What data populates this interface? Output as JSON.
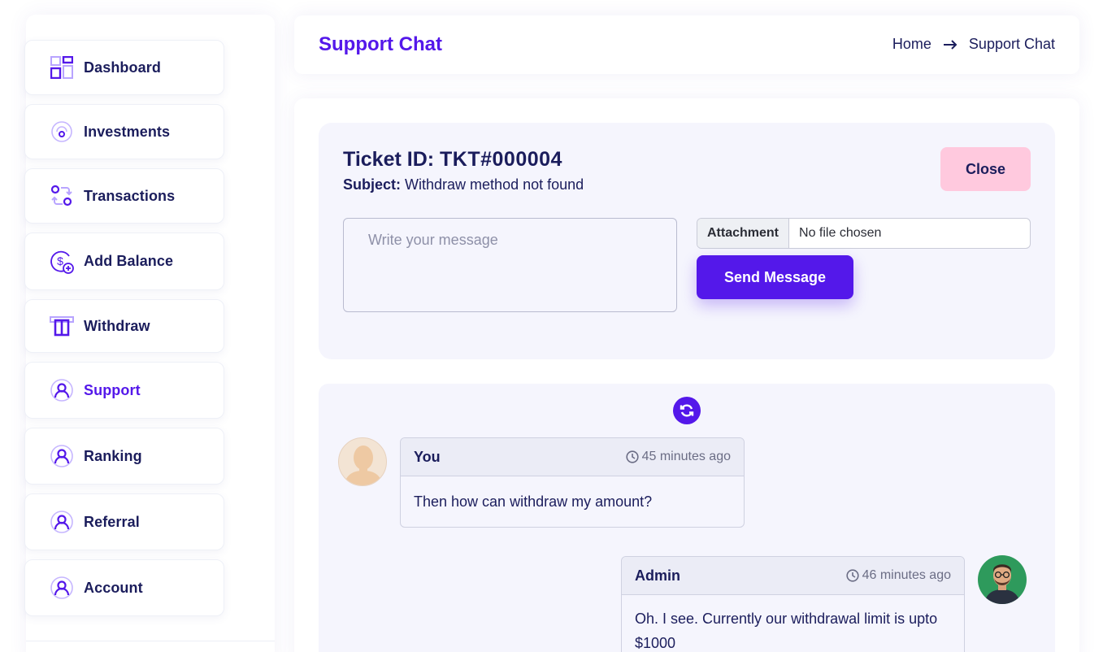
{
  "sidebar": {
    "items": [
      {
        "label": "Dashboard",
        "icon": "dashboard-icon"
      },
      {
        "label": "Investments",
        "icon": "investments-icon"
      },
      {
        "label": "Transactions",
        "icon": "transactions-icon"
      },
      {
        "label": "Add Balance",
        "icon": "add-balance-icon"
      },
      {
        "label": "Withdraw",
        "icon": "withdraw-icon"
      },
      {
        "label": "Support",
        "icon": "user-icon",
        "active": true
      },
      {
        "label": "Ranking",
        "icon": "user-icon"
      },
      {
        "label": "Referral",
        "icon": "user-icon"
      },
      {
        "label": "Account",
        "icon": "user-icon"
      }
    ]
  },
  "header": {
    "title": "Support Chat",
    "breadcrumb": {
      "home": "Home",
      "current": "Support Chat"
    }
  },
  "ticket": {
    "id_label": "Ticket ID:",
    "id_value": "TKT#000004",
    "subject_label": "Subject:",
    "subject_value": "Withdraw method not found",
    "close_label": "Close"
  },
  "composer": {
    "message_placeholder": "Write your message",
    "attachment_button": "Attachment",
    "attachment_status": "No file chosen",
    "send_label": "Send Message"
  },
  "messages": [
    {
      "author": "You",
      "time": "45 minutes ago",
      "text": "Then how can withdraw my amount?"
    },
    {
      "author": "Admin",
      "time": "46 minutes ago",
      "text": "Oh. I see. Currently our withdrawal limit is upto $1000"
    }
  ],
  "colors": {
    "accent": "#5418ea",
    "text": "#1b1d5c",
    "close_button": "#ffc9de",
    "panel": "#f5f5fd"
  }
}
